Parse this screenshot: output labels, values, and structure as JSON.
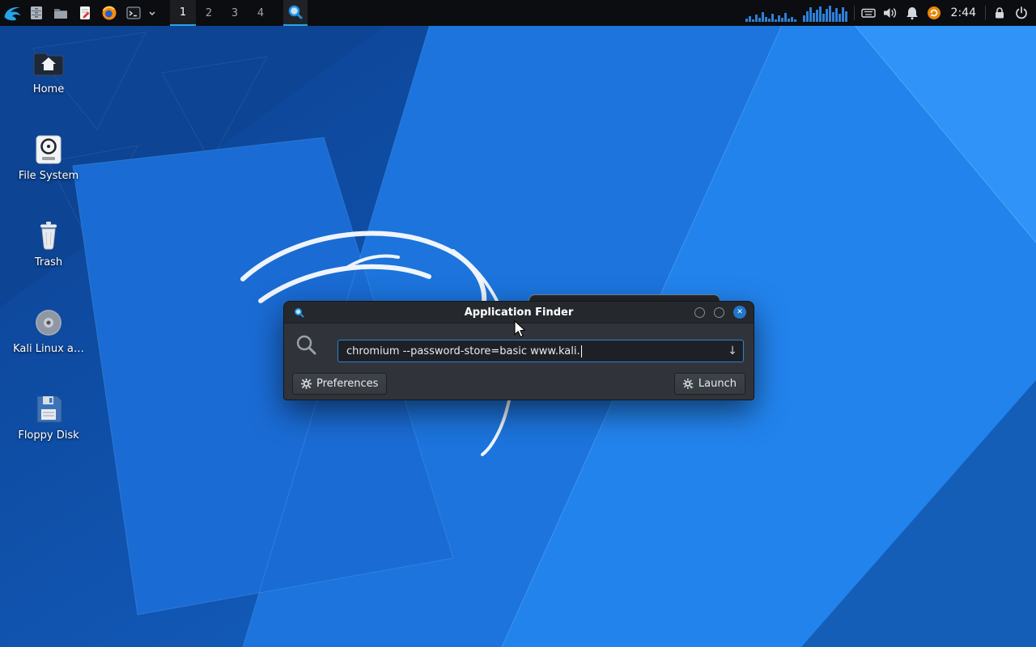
{
  "panel": {
    "launcher_icons": [
      "kali-menu",
      "file-cabinet",
      "folder",
      "text-editor",
      "firefox",
      "terminal",
      "chevron-down"
    ],
    "workspaces": [
      "1",
      "2",
      "3",
      "4"
    ],
    "active_workspace": "1",
    "appfinder_icon": "application-finder",
    "right_icons": [
      "cpu-graph",
      "network-graph",
      "keyboard",
      "volume",
      "bell",
      "update-status",
      "clock",
      "lock",
      "power"
    ],
    "clock": "2:44"
  },
  "desktop_icons": [
    {
      "label": "Home"
    },
    {
      "label": "File System"
    },
    {
      "label": "Trash"
    },
    {
      "label": "Kali Linux a…"
    },
    {
      "label": "Floppy Disk"
    }
  ],
  "finder": {
    "title": "Application Finder",
    "command_value": "chromium --password-store=basic www.kali.",
    "preferences_label": "Preferences",
    "launch_label": "Launch",
    "close_glyph": "✕",
    "dropdown_glyph": "↓"
  },
  "colors": {
    "accent_blue": "#2aa3e8",
    "close_button_blue": "#2176cd",
    "input_focus_border": "#2f7fd0",
    "panel_bg": "#0b0d11",
    "dialog_bg": "#30343a",
    "wallpaper_blue": "#1c74dc"
  }
}
